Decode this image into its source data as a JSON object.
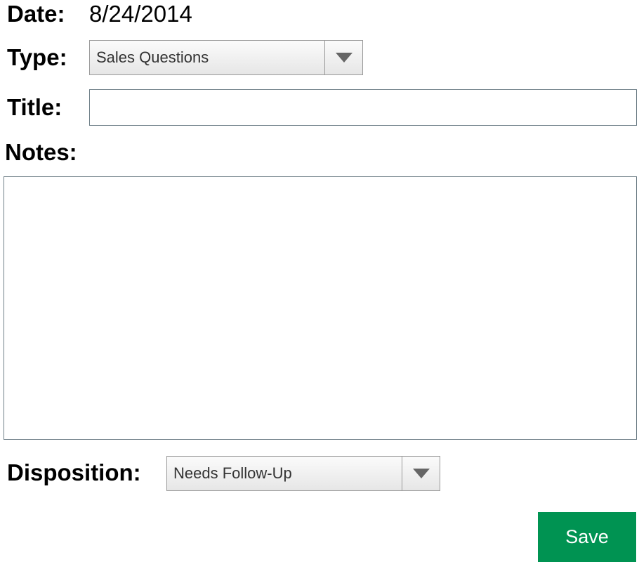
{
  "form": {
    "date": {
      "label": "Date:",
      "value": "8/24/2014"
    },
    "type": {
      "label": "Type:",
      "selected": "Sales Questions",
      "arrow_icon": "triangle-down-icon"
    },
    "title": {
      "label": "Title:",
      "value": "",
      "placeholder": ""
    },
    "notes": {
      "label": "Notes:",
      "value": "",
      "placeholder": ""
    },
    "disposition": {
      "label": "Disposition:",
      "selected": "Needs Follow-Up",
      "arrow_icon": "triangle-down-icon"
    },
    "save_label": "Save"
  },
  "colors": {
    "save_button": "#009352",
    "save_text": "#ffffff",
    "input_border": "#6f7f88",
    "dropdown_border": "#9a9a9a",
    "arrow": "#666666"
  }
}
